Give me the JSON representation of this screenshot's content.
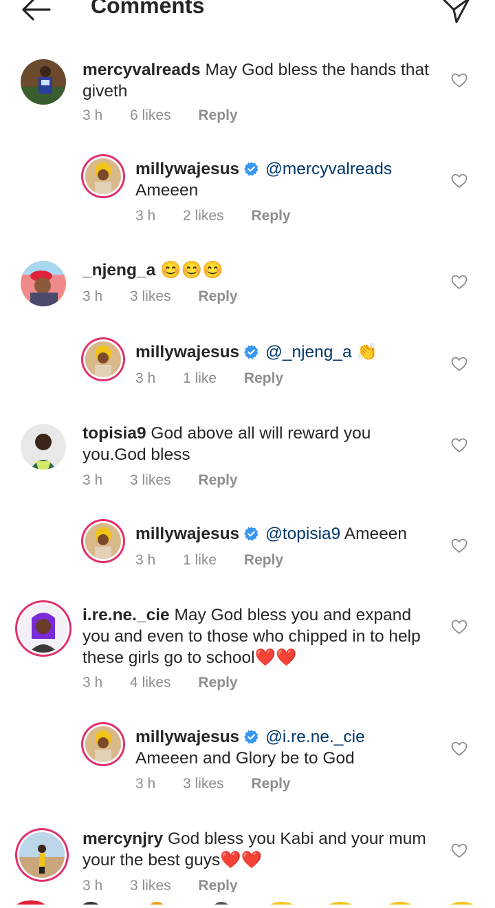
{
  "header": {
    "title": "Comments",
    "back_icon": "arrow-left-icon",
    "send_icon": "send-icon"
  },
  "colors": {
    "accent": "#e1306c",
    "verified": "#3897f0",
    "mention": "#00376b",
    "meta": "#8e8e8e"
  },
  "comments": [
    {
      "user": "mercyvalreads",
      "text": "May God bless the hands that giveth",
      "time": "3 h",
      "likes": "6 likes",
      "reply": "Reply",
      "reply_to": false
    },
    {
      "user": "millywajesus",
      "verified": true,
      "mention": "@mercyvalreads",
      "text": "Ameeen",
      "time": "3 h",
      "likes": "2 likes",
      "reply": "Reply",
      "reply_to": true
    },
    {
      "user": "_njeng_a",
      "text": "😊😊😊",
      "time": "3 h",
      "likes": "3 likes",
      "reply": "Reply",
      "reply_to": false
    },
    {
      "user": "millywajesus",
      "verified": true,
      "mention": "@_njeng_a",
      "text": "👏",
      "time": "3 h",
      "likes": "1 like",
      "reply": "Reply",
      "reply_to": true
    },
    {
      "user": "topisia9",
      "text": "God above all will reward you you.God bless",
      "time": "3 h",
      "likes": "3 likes",
      "reply": "Reply",
      "reply_to": false
    },
    {
      "user": "millywajesus",
      "verified": true,
      "mention": "@topisia9",
      "text": "Ameeen",
      "time": "3 h",
      "likes": "1 like",
      "reply": "Reply",
      "reply_to": true
    },
    {
      "user": "i.re.ne._cie",
      "text": "May God bless you and expand you and even to those who chipped in to help these girls go to school❤️❤️",
      "time": "3 h",
      "likes": "4 likes",
      "reply": "Reply",
      "reply_to": false
    },
    {
      "user": "millywajesus",
      "verified": true,
      "mention": "@i.re.ne._cie",
      "text": "Ameeen and Glory be to God",
      "time": "3 h",
      "likes": "3 likes",
      "reply": "Reply",
      "reply_to": true
    },
    {
      "user": "mercynjry",
      "text": "God bless you Kabi and your mum your the best guys❤️❤️",
      "time": "3 h",
      "likes": "3 likes",
      "reply": "Reply",
      "reply_to": false
    }
  ]
}
